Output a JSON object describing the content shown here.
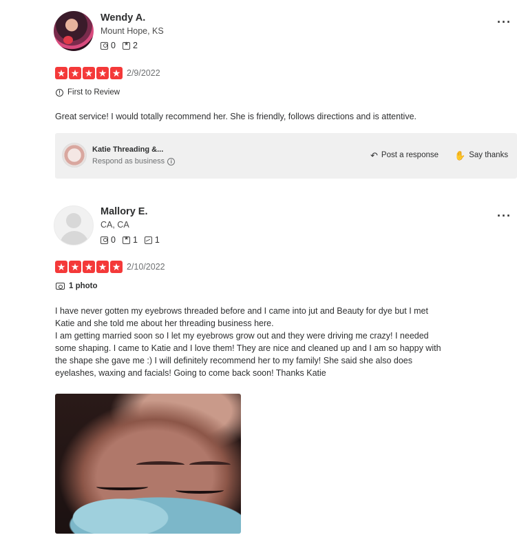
{
  "reviews": [
    {
      "name": "Wendy A.",
      "location": "Mount Hope, KS",
      "stats": {
        "friends": "0",
        "reviews": "2"
      },
      "rating": 5,
      "date": "2/9/2022",
      "badge": "First to Review",
      "text": "Great service! I would totally recommend her. She is friendly, follows directions and is attentive."
    },
    {
      "name": "Mallory E.",
      "location": "CA, CA",
      "stats": {
        "friends": "0",
        "reviews": "1",
        "photos": "1"
      },
      "rating": 5,
      "date": "2/10/2022",
      "badge": "1 photo",
      "text_lines": [
        "I have never gotten my eyebrows threaded before and I came into jut and Beauty for dye but I met",
        "Katie and she told me about her threading business here.",
        "I am getting married soon so I let my eyebrows grow out and they were driving me crazy! I needed",
        "some shaping. I came to Katie and I love them! They are nice and cleaned up and I am so happy with",
        "the shape she gave me :) I will definitely recommend her to my family! She said she also does",
        "eyelashes, waxing and facials! Going to come back soon! Thanks Katie"
      ]
    }
  ],
  "business": {
    "name": "Katie Threading &...",
    "respond_label": "Respond as business",
    "post_response": "Post a response",
    "say_thanks": "Say thanks"
  },
  "icons": {
    "more": "more-options-icon",
    "star": "star-icon",
    "info": "info-icon",
    "camera": "camera-icon"
  },
  "colors": {
    "star_red": "#f43939",
    "text": "#2d2e2f",
    "muted": "#6e7072",
    "panel": "#f0f0f0"
  },
  "more_glyph": "···",
  "star_glyph": "★"
}
